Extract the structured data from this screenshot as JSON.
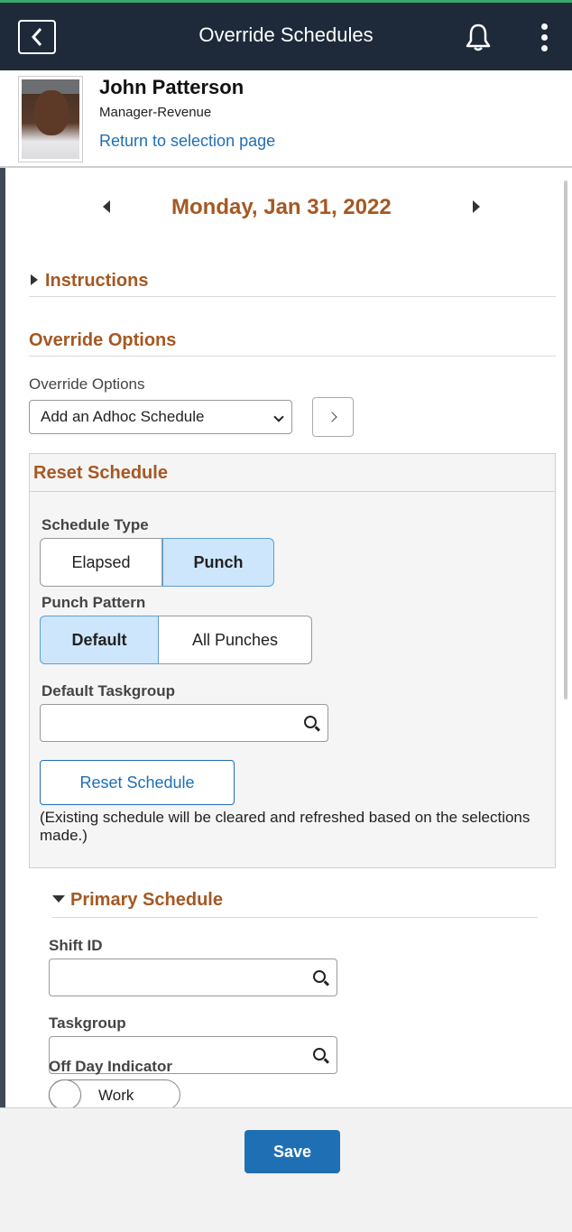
{
  "header": {
    "title": "Override Schedules",
    "back_icon": "chevron-left-icon",
    "notification_icon": "bell-icon",
    "menu_icon": "kebab-menu-icon"
  },
  "person": {
    "name": "John Patterson",
    "role": "Manager-Revenue",
    "return_link": "Return to selection page"
  },
  "date_nav": {
    "date": "Monday, Jan 31, 2022",
    "prev_icon": "triangle-left-icon",
    "next_icon": "triangle-right-icon"
  },
  "instructions": {
    "label": "Instructions"
  },
  "override_options": {
    "section_title": "Override Options",
    "field_label": "Override Options",
    "selected": "Add an Adhoc Schedule",
    "go_icon": "chevron-right-icon"
  },
  "reset_schedule": {
    "title": "Reset Schedule",
    "schedule_type_label": "Schedule Type",
    "schedule_type_options": [
      "Elapsed",
      "Punch"
    ],
    "schedule_type_selected": "Punch",
    "punch_pattern_label": "Punch Pattern",
    "punch_pattern_options": [
      "Default",
      "All Punches"
    ],
    "punch_pattern_selected": "Default",
    "default_taskgroup_label": "Default Taskgroup",
    "default_taskgroup_value": "",
    "button_label": "Reset Schedule",
    "note": "(Existing schedule will be cleared and refreshed based on the selections made.)"
  },
  "primary_schedule": {
    "title": "Primary Schedule",
    "shift_id_label": "Shift ID",
    "shift_id_value": "",
    "taskgroup_label": "Taskgroup",
    "taskgroup_value": "",
    "off_day_label": "Off Day Indicator",
    "off_day_toggle_text": "Work"
  },
  "footer": {
    "save_label": "Save"
  },
  "colors": {
    "header_bg": "#1e2a3a",
    "section_title": "#a55823",
    "link": "#1f6fb5",
    "selected_segment": "#cde6fb",
    "save_button": "#1f6fb5"
  }
}
